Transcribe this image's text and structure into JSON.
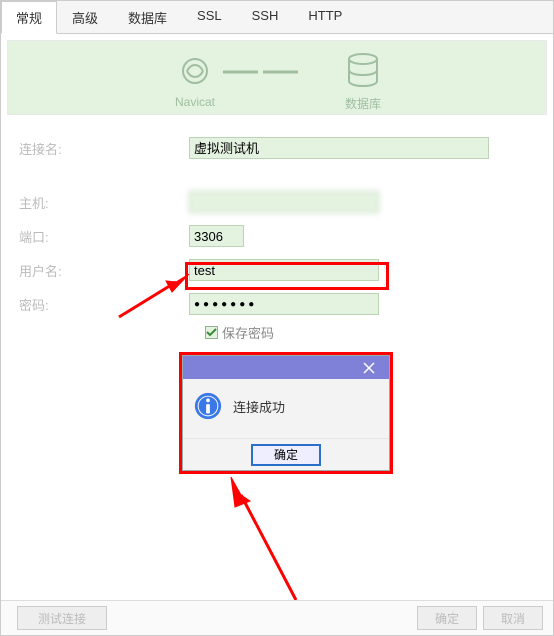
{
  "tabs": {
    "general": "常规",
    "advanced": "高级",
    "database": "数据库",
    "ssl": "SSL",
    "ssh": "SSH",
    "http": "HTTP"
  },
  "diagram": {
    "left": "Navicat",
    "right": "数据库"
  },
  "form": {
    "connName_label": "连接名:",
    "connName_value": "虚拟测试机",
    "host_label": "主机:",
    "host_value": "",
    "port_label": "端口:",
    "port_value": "3306",
    "user_label": "用户名:",
    "user_value": "test",
    "pass_label": "密码:",
    "pass_value": "●●●●●●●",
    "savePass_label": "保存密码"
  },
  "dialog": {
    "message": "连接成功",
    "ok": "确定"
  },
  "footer": {
    "test": "测试连接",
    "ok": "确定",
    "cancel": "取消"
  }
}
